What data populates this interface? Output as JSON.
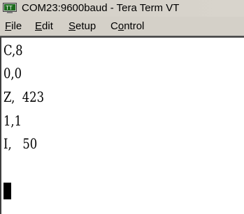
{
  "window": {
    "title": "COM23:9600baud - Tera Term VT"
  },
  "menu": {
    "items": [
      {
        "pre": "",
        "key": "F",
        "post": "ile"
      },
      {
        "pre": "",
        "key": "E",
        "post": "dit"
      },
      {
        "pre": "",
        "key": "S",
        "post": "etup"
      },
      {
        "pre": "C",
        "key": "o",
        "post": "ntrol"
      }
    ]
  },
  "terminal": {
    "lines": [
      "C,8",
      "0,0",
      "Z,  423",
      "1,1",
      "I,   50"
    ]
  },
  "colors": {
    "window_bg": "#d4d0c8",
    "terminal_bg": "#ffffff",
    "terminal_fg": "#000000"
  }
}
